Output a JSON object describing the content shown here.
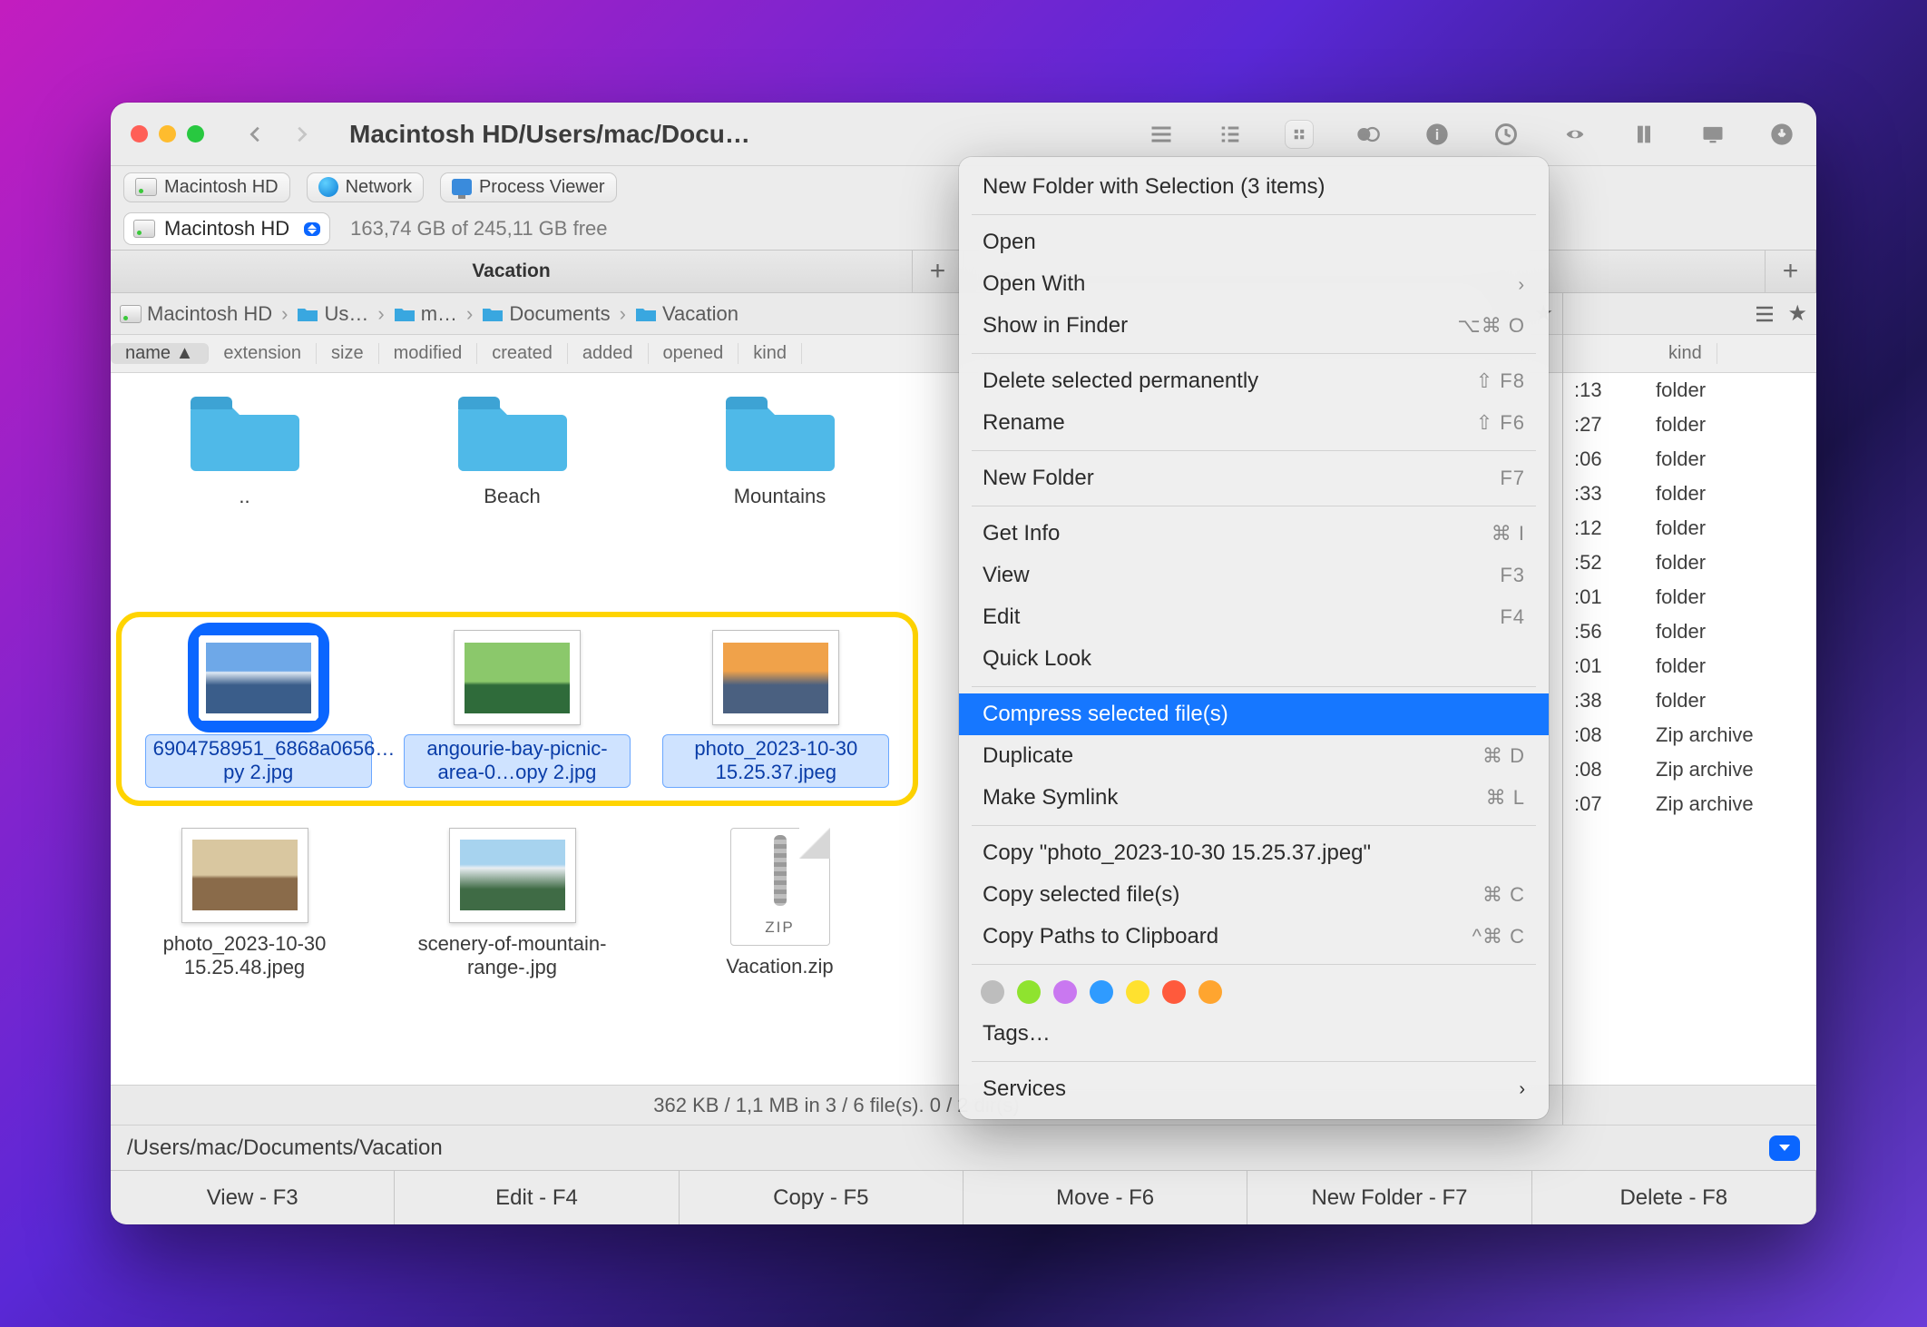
{
  "window_title": "Macintosh HD/Users/mac/Docu…",
  "favorites": [
    {
      "label": "Macintosh HD",
      "icon": "hd"
    },
    {
      "label": "Network",
      "icon": "globe"
    },
    {
      "label": "Process Viewer",
      "icon": "monitor"
    }
  ],
  "disk_selector": "Macintosh HD",
  "disk_free": "163,74 GB of 245,11 GB free",
  "tabs": {
    "left": "Vacation",
    "right": ""
  },
  "breadcrumb_left": [
    "Macintosh HD",
    "Us…",
    "m…",
    "Documents",
    "Vacation"
  ],
  "columns_left": [
    "name ▲",
    "extension",
    "size",
    "modified",
    "created",
    "added",
    "opened",
    "kind"
  ],
  "columns_right": [
    "kind"
  ],
  "icons_row1": [
    {
      "name": "..",
      "type": "folder"
    },
    {
      "name": "Beach",
      "type": "folder"
    },
    {
      "name": "Mountains",
      "type": "folder"
    }
  ],
  "selected_files": [
    {
      "name": "6904758951_6868a0656…py 2.jpg",
      "primary": true
    },
    {
      "name": "angourie-bay-picnic-area-0…opy 2.jpg",
      "primary": false
    },
    {
      "name": "photo_2023-10-30 15.25.37.jpeg",
      "primary": false
    }
  ],
  "icons_row3": [
    {
      "name": "photo_2023-10-30 15.25.48.jpeg",
      "type": "image"
    },
    {
      "name": "scenery-of-mountain-range-.jpg",
      "type": "image"
    },
    {
      "name": "Vacation.zip",
      "type": "zip"
    }
  ],
  "right_rows": [
    {
      "t": ":13",
      "k": "folder"
    },
    {
      "t": ":27",
      "k": "folder"
    },
    {
      "t": ":06",
      "k": "folder"
    },
    {
      "t": ":33",
      "k": "folder"
    },
    {
      "t": ":12",
      "k": "folder"
    },
    {
      "t": ":52",
      "k": "folder"
    },
    {
      "t": ":01",
      "k": "folder"
    },
    {
      "t": ":56",
      "k": "folder"
    },
    {
      "t": ":01",
      "k": "folder"
    },
    {
      "t": ":38",
      "k": "folder"
    },
    {
      "t": ":08",
      "k": "Zip archive"
    },
    {
      "t": ":08",
      "k": "Zip archive"
    },
    {
      "t": ":07",
      "k": "Zip archive"
    }
  ],
  "status_text": "362 KB / 1,1 MB in 3 / 6 file(s). 0 / 2 dir(s)",
  "path_footer": "/Users/mac/Documents/Vacation",
  "fkeys": [
    "View - F3",
    "Edit - F4",
    "Copy - F5",
    "Move - F6",
    "New Folder - F7",
    "Delete - F8"
  ],
  "context_menu": {
    "groups": [
      [
        {
          "label": "New Folder with Selection (3 items)",
          "sc": ""
        }
      ],
      [
        {
          "label": "Open",
          "sc": ""
        },
        {
          "label": "Open With",
          "sc": "",
          "submenu": true
        },
        {
          "label": "Show in Finder",
          "sc": "⌥⌘ O"
        }
      ],
      [
        {
          "label": "Delete selected permanently",
          "sc": "⇧ F8"
        },
        {
          "label": "Rename",
          "sc": "⇧ F6"
        }
      ],
      [
        {
          "label": "New Folder",
          "sc": "F7"
        }
      ],
      [
        {
          "label": "Get Info",
          "sc": "⌘ I"
        },
        {
          "label": "View",
          "sc": "F3"
        },
        {
          "label": "Edit",
          "sc": "F4"
        },
        {
          "label": "Quick Look",
          "sc": ""
        }
      ],
      [
        {
          "label": "Compress selected file(s)",
          "sc": "",
          "highlight": true
        },
        {
          "label": "Duplicate",
          "sc": "⌘ D"
        },
        {
          "label": "Make Symlink",
          "sc": "⌘ L"
        }
      ],
      [
        {
          "label": "Copy \"photo_2023-10-30 15.25.37.jpeg\"",
          "sc": ""
        },
        {
          "label": "Copy selected file(s)",
          "sc": "⌘ C"
        },
        {
          "label": "Copy Paths to Clipboard",
          "sc": "^⌘ C"
        }
      ]
    ],
    "tag_colors": [
      "#bdbdbd",
      "#8fe32f",
      "#c978f0",
      "#2f9bff",
      "#ffe12f",
      "#ff5a3c",
      "#ffa52f"
    ],
    "tags_label": "Tags…",
    "services_label": "Services"
  }
}
